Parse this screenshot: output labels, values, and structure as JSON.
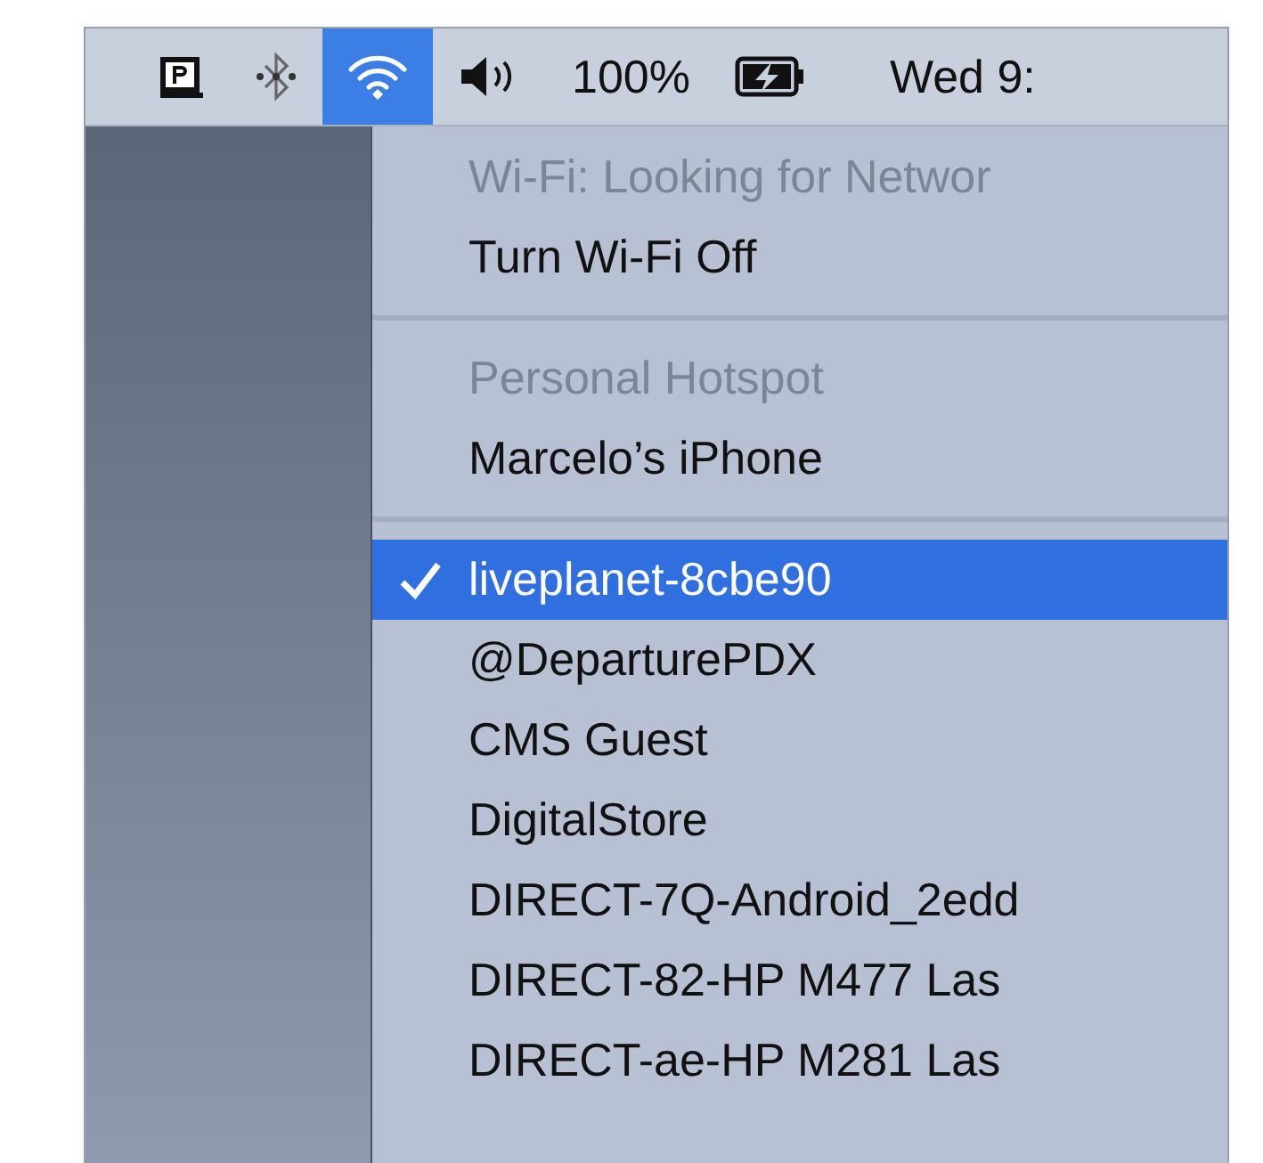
{
  "menubar": {
    "items": [
      {
        "kind": "app",
        "selected": false
      },
      {
        "kind": "bluetooth",
        "selected": false
      },
      {
        "kind": "wifi",
        "selected": true
      },
      {
        "kind": "volume",
        "selected": false
      },
      {
        "kind": "text",
        "text": "100%",
        "selected": false
      },
      {
        "kind": "battery",
        "selected": false
      },
      {
        "kind": "text",
        "text": "Wed 9:",
        "selected": false
      }
    ]
  },
  "wifi_menu": {
    "items": [
      {
        "kind": "header",
        "label": "Wi-Fi: Looking for Networ"
      },
      {
        "kind": "action",
        "label": "Turn Wi-Fi Off"
      },
      {
        "kind": "separator"
      },
      {
        "kind": "header",
        "label": "Personal Hotspot"
      },
      {
        "kind": "action",
        "label": "Marcelo’s iPhone"
      },
      {
        "kind": "separator"
      },
      {
        "kind": "network",
        "label": "liveplanet-8cbe90",
        "selected": true
      },
      {
        "kind": "network",
        "label": "@DeparturePDX",
        "selected": false
      },
      {
        "kind": "network",
        "label": "CMS Guest",
        "selected": false
      },
      {
        "kind": "network",
        "label": "DigitalStore",
        "selected": false
      },
      {
        "kind": "network",
        "label": "DIRECT-7Q-Android_2edd",
        "selected": false
      },
      {
        "kind": "network",
        "label": "DIRECT-82-HP M477 Las",
        "selected": false
      },
      {
        "kind": "network",
        "label": "DIRECT-ae-HP M281 Las",
        "selected": false
      }
    ]
  }
}
